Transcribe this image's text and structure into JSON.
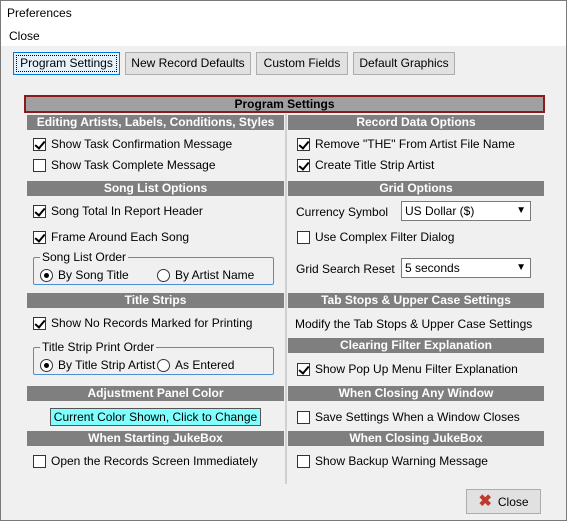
{
  "window": {
    "title": "Preferences"
  },
  "menu": {
    "close": "Close"
  },
  "tabs": [
    {
      "label": "Program Settings",
      "active": true
    },
    {
      "label": "New Record Defaults",
      "active": false
    },
    {
      "label": "Custom Fields",
      "active": false
    },
    {
      "label": "Default Graphics",
      "active": false
    }
  ],
  "main_header": "Program Settings",
  "sections": {
    "editing": "Editing Artists, Labels, Conditions, Styles",
    "record_data": "Record Data Options",
    "song_list": "Song List Options",
    "grid": "Grid Options",
    "title_strips": "Title Strips",
    "tab_stops": "Tab Stops & Upper Case Settings",
    "clearing_filter": "Clearing Filter Explanation",
    "adjustment": "Adjustment Panel Color",
    "closing_window": "When Closing Any Window",
    "starting": "When Starting JukeBox",
    "closing_jukebox": "When Closing JukeBox"
  },
  "options": {
    "task_confirm": {
      "label": "Show Task Confirmation Message",
      "checked": true
    },
    "task_complete": {
      "label": "Show Task Complete Message",
      "checked": false
    },
    "remove_the": {
      "label": "Remove \"THE\" From Artist File Name",
      "checked": true
    },
    "create_strip": {
      "label": "Create Title Strip Artist",
      "checked": true
    },
    "song_total": {
      "label": "Song Total In Report Header",
      "checked": true
    },
    "frame_around": {
      "label": "Frame Around Each Song",
      "checked": true
    },
    "complex_filter": {
      "label": "Use Complex Filter Dialog",
      "checked": false
    },
    "no_records": {
      "label": "Show No Records Marked for Printing",
      "checked": true
    },
    "popup_filter": {
      "label": "Show Pop Up Menu Filter Explanation",
      "checked": true
    },
    "save_settings": {
      "label": "Save Settings When a Window Closes",
      "checked": false
    },
    "open_records": {
      "label": "Open the Records Screen Immediately",
      "checked": false
    },
    "backup_warning": {
      "label": "Show Backup Warning Message",
      "checked": false
    }
  },
  "song_list_order": {
    "label": "Song List Order",
    "by_title": "By Song Title",
    "by_artist": "By Artist Name",
    "selected": "by_title"
  },
  "title_strip_order": {
    "label": "Title Strip Print Order",
    "by_artist": "By Title Strip Artist",
    "as_entered": "As Entered",
    "selected": "by_artist"
  },
  "currency": {
    "label": "Currency Symbol",
    "value": "US Dollar ($)"
  },
  "grid_reset": {
    "label": "Grid Search Reset",
    "value": "5 seconds"
  },
  "tab_stops_link": "Modify the Tab Stops & Upper Case Settings",
  "color_button": "Current Color Shown, Click to Change",
  "colors": {
    "panel_color": "#80ffff",
    "section_header": "#7f7f7f",
    "close_icon": "#c0392b"
  },
  "close_button": "Close"
}
